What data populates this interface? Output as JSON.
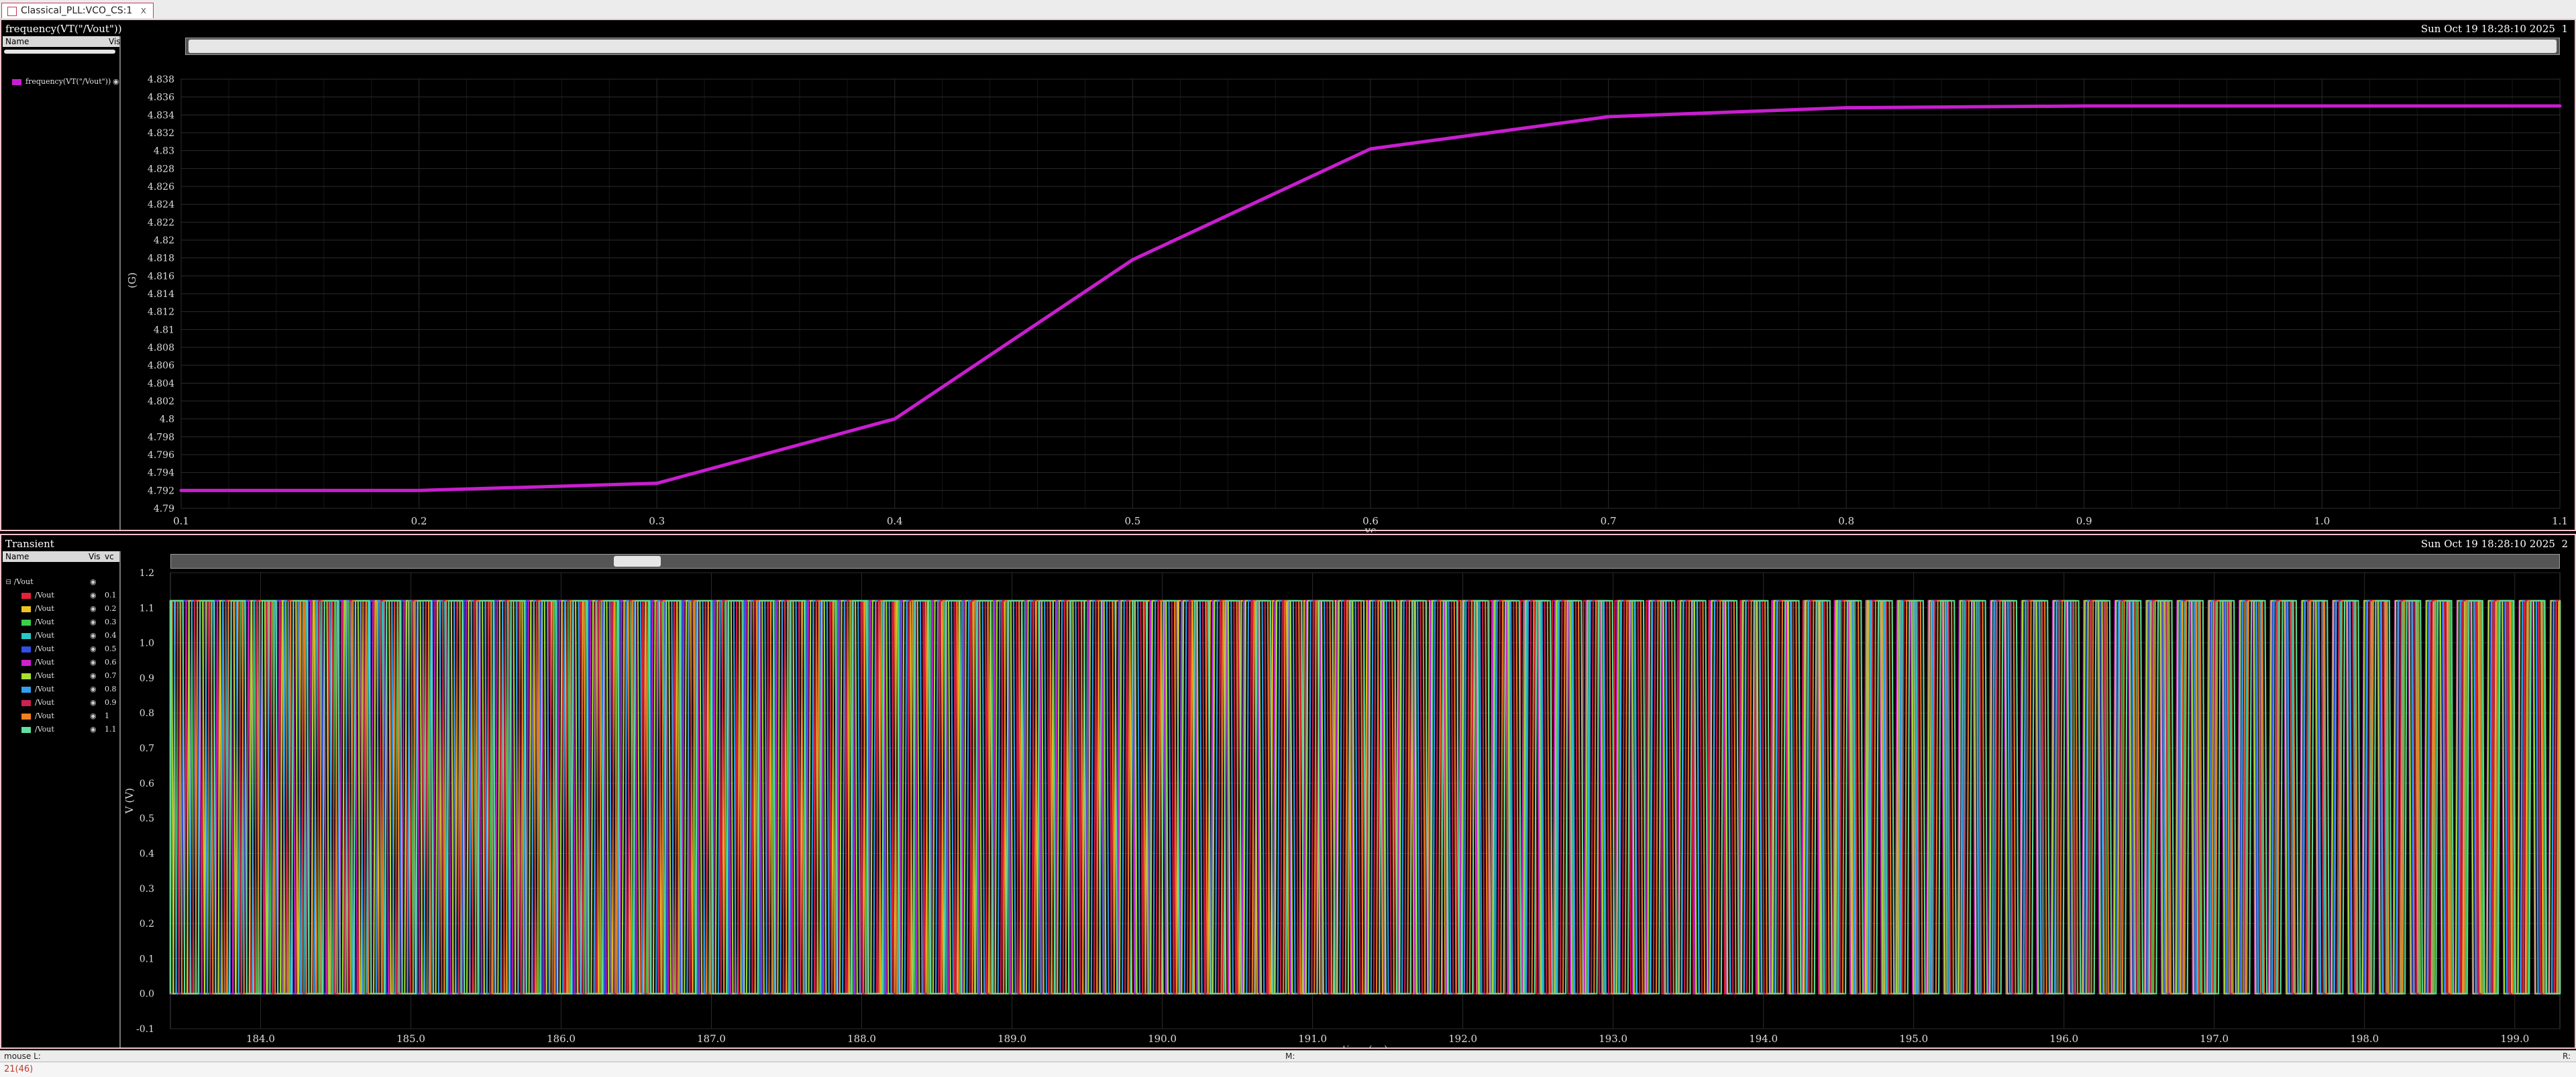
{
  "tab": {
    "title": "Classical_PLL:VCO_CS:1",
    "close": "x"
  },
  "top_panel": {
    "title": "frequency(VT(\"/Vout\"))",
    "date": "Sun Oct 19 18:28:10 2025",
    "number": "1",
    "legend_header": {
      "name": "Name",
      "vis": "Vis"
    },
    "legend_items": [
      {
        "label": "frequency(VT(\"/Vout\"))",
        "color": "#c81ecf"
      }
    ]
  },
  "bottom_panel": {
    "title": "Transient",
    "date": "Sun Oct 19 18:28:10 2025",
    "number": "2",
    "legend_header": {
      "name": "Name",
      "vis": "Vis",
      "vc": "vc"
    },
    "group_label": "/Vout",
    "legend_items": [
      {
        "label": "/Vout",
        "vc": "0.1",
        "color": "#e8203a"
      },
      {
        "label": "/Vout",
        "vc": "0.2",
        "color": "#f0c420"
      },
      {
        "label": "/Vout",
        "vc": "0.3",
        "color": "#3ad04a"
      },
      {
        "label": "/Vout",
        "vc": "0.4",
        "color": "#28c8c8"
      },
      {
        "label": "/Vout",
        "vc": "0.5",
        "color": "#3050e8"
      },
      {
        "label": "/Vout",
        "vc": "0.6",
        "color": "#d020d0"
      },
      {
        "label": "/Vout",
        "vc": "0.7",
        "color": "#a8e030"
      },
      {
        "label": "/Vout",
        "vc": "0.8",
        "color": "#30a0f0"
      },
      {
        "label": "/Vout",
        "vc": "0.9",
        "color": "#d02050"
      },
      {
        "label": "/Vout",
        "vc": "1",
        "color": "#f08020"
      },
      {
        "label": "/Vout",
        "vc": "1.1",
        "color": "#60e0a0"
      }
    ]
  },
  "statusbar": {
    "left": "mouse L:",
    "middle": "M:",
    "right": "R:"
  },
  "statusbar2": {
    "left": "21(46)"
  },
  "chart_data": [
    {
      "type": "line",
      "title": "frequency(VT(\"/Vout\"))",
      "xlabel": "vc",
      "ylabel": "(G)",
      "xlim": [
        0.1,
        1.1
      ],
      "ylim": [
        4.79,
        4.838
      ],
      "grid": true,
      "legend_placement": "left-panel",
      "x_ticks": [
        "0.1",
        "0.2",
        "0.3",
        "0.4",
        "0.5",
        "0.6",
        "0.7",
        "0.8",
        "0.9",
        "1.0",
        "1.1"
      ],
      "y_ticks": [
        "4.79",
        "4.792",
        "4.794",
        "4.796",
        "4.798",
        "4.8",
        "4.802",
        "4.804",
        "4.806",
        "4.808",
        "4.81",
        "4.812",
        "4.814",
        "4.816",
        "4.818",
        "4.82",
        "4.822",
        "4.824",
        "4.826",
        "4.828",
        "4.83",
        "4.832",
        "4.834",
        "4.836",
        "4.838"
      ],
      "series": [
        {
          "name": "frequency(VT(\"/Vout\"))",
          "color": "#c81ecf",
          "x": [
            0.1,
            0.2,
            0.3,
            0.4,
            0.5,
            0.6,
            0.7,
            0.8,
            0.9,
            1.0,
            1.1
          ],
          "y": [
            4.792,
            4.792,
            4.7928,
            4.8,
            4.8178,
            4.8302,
            4.8338,
            4.8348,
            4.835,
            4.835,
            4.835
          ]
        }
      ]
    },
    {
      "type": "line",
      "title": "Transient",
      "xlabel": "time (ns)",
      "ylabel": "V (V)",
      "xlim": [
        183.4,
        199.3
      ],
      "ylim": [
        -0.1,
        1.2
      ],
      "grid": true,
      "legend_placement": "left-panel",
      "x_ticks": [
        "184.0",
        "185.0",
        "186.0",
        "187.0",
        "188.0",
        "189.0",
        "190.0",
        "191.0",
        "192.0",
        "193.0",
        "194.0",
        "195.0",
        "196.0",
        "197.0",
        "198.0",
        "199.0"
      ],
      "y_ticks": [
        "-0.1",
        "0.0",
        "0.1",
        "0.2",
        "0.3",
        "0.4",
        "0.5",
        "0.6",
        "0.7",
        "0.8",
        "0.9",
        "1.0",
        "1.1",
        "1.2"
      ],
      "waveform": {
        "low_v": 0.0,
        "high_v": 1.12
      },
      "series": [
        {
          "name": "0.1",
          "period_ns": 0.2087,
          "phase": 0.0
        },
        {
          "name": "0.2",
          "period_ns": 0.2087,
          "phase": 0.09
        },
        {
          "name": "0.3",
          "period_ns": 0.2087,
          "phase": 0.18
        },
        {
          "name": "0.4",
          "period_ns": 0.2083,
          "phase": 0.27
        },
        {
          "name": "0.5",
          "period_ns": 0.2075,
          "phase": 0.36
        },
        {
          "name": "0.6",
          "period_ns": 0.207,
          "phase": 0.45
        },
        {
          "name": "0.7",
          "period_ns": 0.2068,
          "phase": 0.54
        },
        {
          "name": "0.8",
          "period_ns": 0.2068,
          "phase": 0.63
        },
        {
          "name": "0.9",
          "period_ns": 0.2068,
          "phase": 0.72
        },
        {
          "name": "1",
          "period_ns": 0.2068,
          "phase": 0.81
        },
        {
          "name": "1.1",
          "period_ns": 0.2068,
          "phase": 0.9
        }
      ]
    }
  ]
}
